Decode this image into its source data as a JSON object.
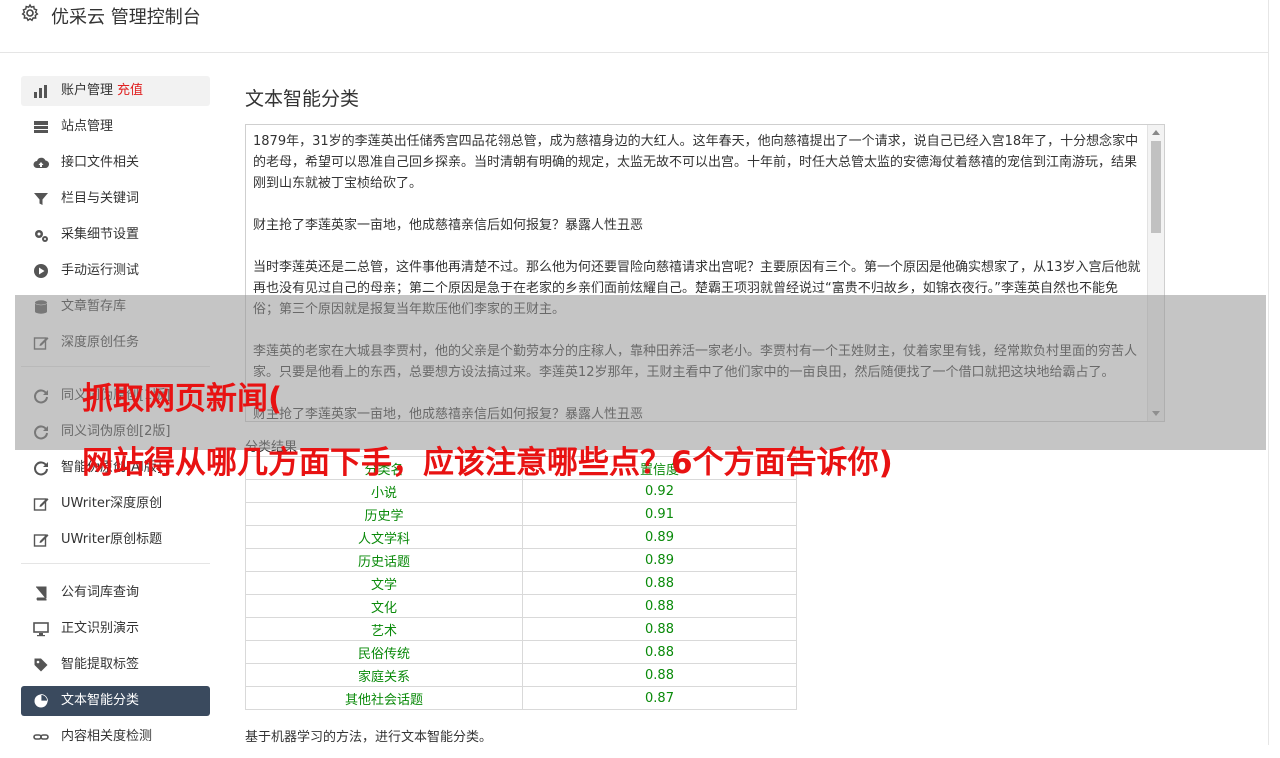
{
  "app": {
    "title": "优采云 管理控制台"
  },
  "sidebar": {
    "group1": [
      {
        "label": "账户管理",
        "badge": "充值",
        "icon": "bar-chart-icon"
      },
      {
        "label": "站点管理",
        "icon": "server-icon"
      },
      {
        "label": "接口文件相关",
        "icon": "cloud-upload-icon"
      },
      {
        "label": "栏目与关键词",
        "icon": "filter-icon"
      },
      {
        "label": "采集细节设置",
        "icon": "gears-icon"
      },
      {
        "label": "手动运行测试",
        "icon": "play-icon"
      },
      {
        "label": "文章暂存库",
        "icon": "database-icon"
      },
      {
        "label": "深度原创任务",
        "icon": "edit-icon"
      }
    ],
    "group2": [
      {
        "label": "同义词伪原创[1版]",
        "icon": "refresh-icon"
      },
      {
        "label": "同义词伪原创[2版]",
        "icon": "refresh-icon"
      },
      {
        "label": "智能伪原创[AI版]",
        "icon": "refresh-icon"
      },
      {
        "label": "UWriter深度原创",
        "icon": "edit-icon"
      },
      {
        "label": "UWriter原创标题",
        "icon": "edit-icon"
      }
    ],
    "group3": [
      {
        "label": "公有词库查询",
        "icon": "book-icon"
      },
      {
        "label": "正文识别演示",
        "icon": "monitor-icon"
      },
      {
        "label": "智能提取标签",
        "icon": "tag-icon"
      },
      {
        "label": "文本智能分类",
        "icon": "pie-chart-icon"
      },
      {
        "label": "内容相关度检测",
        "icon": "link-icon"
      }
    ]
  },
  "main": {
    "title": "文本智能分类",
    "input_text": "1879年，31岁的李莲英出任储秀宫四品花翎总管，成为慈禧身边的大红人。这年春天，他向慈禧提出了一个请求，说自己已经入宫18年了，十分想念家中的老母，希望可以恩准自己回乡探亲。当时清朝有明确的规定，太监无故不可以出宫。十年前，时任大总管太监的安德海仗着慈禧的宠信到江南游玩，结果刚到山东就被丁宝桢给砍了。\n\n财主抢了李莲英家一亩地，他成慈禧亲信后如何报复？暴露人性丑恶\n\n当时李莲英还是二总管，这件事他再清楚不过。那么他为何还要冒险向慈禧请求出宫呢？主要原因有三个。第一个原因是他确实想家了，从13岁入宫后他就再也没有见过自己的母亲；第二个原因是急于在老家的乡亲们面前炫耀自己。楚霸王项羽就曾经说过“富贵不归故乡，如锦衣夜行。”李莲英自然也不能免俗；第三个原因就是报复当年欺压他们李家的王财主。\n\n李莲英的老家在大城县李贾村，他的父亲是个勤劳本分的庄稼人，靠种田养活一家老小。李贾村有一个王姓财主，仗着家里有钱，经常欺负村里面的穷苦人家。只要是他看上的东西，总要想方设法搞过来。李莲英12岁那年，王财主看中了他们家中的一亩良田，然后随便找了一个借口就把这块地给霸占了。\n\n财主抢了李莲英家一亩地，他成慈禧亲信后如何报复？暴露人性丑恶",
    "result_label": "分类结果",
    "table": {
      "headers": [
        "分类名",
        "置信度"
      ],
      "rows": [
        [
          "小说",
          "0.92"
        ],
        [
          "历史学",
          "0.91"
        ],
        [
          "人文学科",
          "0.89"
        ],
        [
          "历史话题",
          "0.89"
        ],
        [
          "文学",
          "0.88"
        ],
        [
          "文化",
          "0.88"
        ],
        [
          "艺术",
          "0.88"
        ],
        [
          "民俗传统",
          "0.88"
        ],
        [
          "家庭关系",
          "0.88"
        ],
        [
          "其他社会话题",
          "0.87"
        ]
      ]
    },
    "footnote": "基于机器学习的方法，进行文本智能分类。"
  },
  "overlay": {
    "line1": "抓取网页新闻(",
    "line2": "网站得从哪几方面下手，应该注意哪些点？6个方面告诉你)"
  },
  "colors": {
    "accent_red": "#e81212",
    "active_bg": "#3a4a5e",
    "value_green": "#0a8a0a"
  }
}
